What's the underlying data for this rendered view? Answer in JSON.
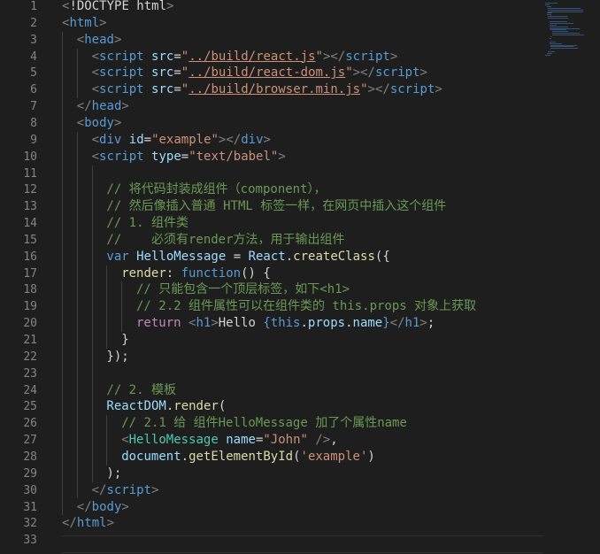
{
  "editor": {
    "line_numbers": [
      "1",
      "2",
      "3",
      "4",
      "5",
      "6",
      "7",
      "8",
      "9",
      "10",
      "11",
      "12",
      "13",
      "14",
      "15",
      "16",
      "17",
      "18",
      "19",
      "20",
      "21",
      "22",
      "23",
      "24",
      "25",
      "26",
      "27",
      "28",
      "29",
      "30",
      "31",
      "32",
      "33"
    ],
    "lines": [
      {
        "indent": 0,
        "tokens": [
          {
            "t": "<",
            "c": "punc"
          },
          {
            "t": "!DOCTYPE html",
            "c": "doctype"
          },
          {
            "t": ">",
            "c": "punc"
          }
        ]
      },
      {
        "indent": 0,
        "tokens": [
          {
            "t": "<",
            "c": "punc"
          },
          {
            "t": "html",
            "c": "tag"
          },
          {
            "t": ">",
            "c": "punc"
          }
        ]
      },
      {
        "indent": 1,
        "tokens": [
          {
            "t": "<",
            "c": "punc"
          },
          {
            "t": "head",
            "c": "tag"
          },
          {
            "t": ">",
            "c": "punc"
          }
        ]
      },
      {
        "indent": 2,
        "tokens": [
          {
            "t": "<",
            "c": "punc"
          },
          {
            "t": "script",
            "c": "tag"
          },
          {
            "t": " ",
            "c": "txt"
          },
          {
            "t": "src",
            "c": "attr"
          },
          {
            "t": "=",
            "c": "txt"
          },
          {
            "t": "\"",
            "c": "str"
          },
          {
            "t": "../build/react.js",
            "c": "link"
          },
          {
            "t": "\"",
            "c": "str"
          },
          {
            "t": "></",
            "c": "punc"
          },
          {
            "t": "script",
            "c": "tag"
          },
          {
            "t": ">",
            "c": "punc"
          }
        ]
      },
      {
        "indent": 2,
        "tokens": [
          {
            "t": "<",
            "c": "punc"
          },
          {
            "t": "script",
            "c": "tag"
          },
          {
            "t": " ",
            "c": "txt"
          },
          {
            "t": "src",
            "c": "attr"
          },
          {
            "t": "=",
            "c": "txt"
          },
          {
            "t": "\"",
            "c": "str"
          },
          {
            "t": "../build/react-dom.js",
            "c": "link"
          },
          {
            "t": "\"",
            "c": "str"
          },
          {
            "t": "></",
            "c": "punc"
          },
          {
            "t": "script",
            "c": "tag"
          },
          {
            "t": ">",
            "c": "punc"
          }
        ]
      },
      {
        "indent": 2,
        "tokens": [
          {
            "t": "<",
            "c": "punc"
          },
          {
            "t": "script",
            "c": "tag"
          },
          {
            "t": " ",
            "c": "txt"
          },
          {
            "t": "src",
            "c": "attr"
          },
          {
            "t": "=",
            "c": "txt"
          },
          {
            "t": "\"",
            "c": "str"
          },
          {
            "t": "../build/browser.min.js",
            "c": "link"
          },
          {
            "t": "\"",
            "c": "str"
          },
          {
            "t": "></",
            "c": "punc"
          },
          {
            "t": "script",
            "c": "tag"
          },
          {
            "t": ">",
            "c": "punc"
          }
        ]
      },
      {
        "indent": 1,
        "tokens": [
          {
            "t": "</",
            "c": "punc"
          },
          {
            "t": "head",
            "c": "tag"
          },
          {
            "t": ">",
            "c": "punc"
          }
        ]
      },
      {
        "indent": 1,
        "tokens": [
          {
            "t": "<",
            "c": "punc"
          },
          {
            "t": "body",
            "c": "tag"
          },
          {
            "t": ">",
            "c": "punc"
          }
        ]
      },
      {
        "indent": 2,
        "tokens": [
          {
            "t": "<",
            "c": "punc"
          },
          {
            "t": "div",
            "c": "tag"
          },
          {
            "t": " ",
            "c": "txt"
          },
          {
            "t": "id",
            "c": "attr"
          },
          {
            "t": "=",
            "c": "txt"
          },
          {
            "t": "\"example\"",
            "c": "str"
          },
          {
            "t": "></",
            "c": "punc"
          },
          {
            "t": "div",
            "c": "tag"
          },
          {
            "t": ">",
            "c": "punc"
          }
        ]
      },
      {
        "indent": 2,
        "tokens": [
          {
            "t": "<",
            "c": "punc"
          },
          {
            "t": "script",
            "c": "tag"
          },
          {
            "t": " ",
            "c": "txt"
          },
          {
            "t": "type",
            "c": "attr"
          },
          {
            "t": "=",
            "c": "txt"
          },
          {
            "t": "\"text/babel\"",
            "c": "str"
          },
          {
            "t": ">",
            "c": "punc"
          }
        ]
      },
      {
        "indent": 0,
        "tokens": []
      },
      {
        "indent": 3,
        "tokens": [
          {
            "t": "// 将代码封装成组件（component），",
            "c": "com"
          }
        ]
      },
      {
        "indent": 3,
        "tokens": [
          {
            "t": "// 然后像插入普通 HTML 标签一样，在网页中插入这个组件",
            "c": "com"
          }
        ]
      },
      {
        "indent": 3,
        "tokens": [
          {
            "t": "// 1. 组件类",
            "c": "com"
          }
        ]
      },
      {
        "indent": 3,
        "tokens": [
          {
            "t": "//    必须有render方法，用于输出组件",
            "c": "com"
          }
        ]
      },
      {
        "indent": 3,
        "tokens": [
          {
            "t": "var",
            "c": "kw"
          },
          {
            "t": " ",
            "c": "txt"
          },
          {
            "t": "HelloMessage",
            "c": "var"
          },
          {
            "t": " = ",
            "c": "txt"
          },
          {
            "t": "React",
            "c": "var"
          },
          {
            "t": ".",
            "c": "txt"
          },
          {
            "t": "createClass",
            "c": "fn"
          },
          {
            "t": "({",
            "c": "txt"
          }
        ]
      },
      {
        "indent": 4,
        "tokens": [
          {
            "t": "render",
            "c": "fn"
          },
          {
            "t": ": ",
            "c": "txt"
          },
          {
            "t": "function",
            "c": "kw"
          },
          {
            "t": "() {",
            "c": "txt"
          }
        ]
      },
      {
        "indent": 5,
        "tokens": [
          {
            "t": "// 只能包含一个顶层标签，如下<h1>",
            "c": "com"
          }
        ]
      },
      {
        "indent": 5,
        "tokens": [
          {
            "t": "// 2.2 组件属性可以在组件类的 this.props 对象上获取",
            "c": "com"
          }
        ]
      },
      {
        "indent": 5,
        "tokens": [
          {
            "t": "return",
            "c": "ctrl"
          },
          {
            "t": " ",
            "c": "txt"
          },
          {
            "t": "<",
            "c": "punc"
          },
          {
            "t": "h1",
            "c": "tag"
          },
          {
            "t": ">",
            "c": "punc"
          },
          {
            "t": "Hello ",
            "c": "txt"
          },
          {
            "t": "{",
            "c": "brace"
          },
          {
            "t": "this",
            "c": "kw"
          },
          {
            "t": ".",
            "c": "txt"
          },
          {
            "t": "props",
            "c": "var"
          },
          {
            "t": ".",
            "c": "txt"
          },
          {
            "t": "name",
            "c": "var"
          },
          {
            "t": "}",
            "c": "brace"
          },
          {
            "t": "</",
            "c": "punc"
          },
          {
            "t": "h1",
            "c": "tag"
          },
          {
            "t": ">",
            "c": "punc"
          },
          {
            "t": ";",
            "c": "txt"
          }
        ]
      },
      {
        "indent": 4,
        "tokens": [
          {
            "t": "}",
            "c": "txt"
          }
        ]
      },
      {
        "indent": 3,
        "tokens": [
          {
            "t": "});",
            "c": "txt"
          }
        ]
      },
      {
        "indent": 0,
        "tokens": []
      },
      {
        "indent": 3,
        "tokens": [
          {
            "t": "// 2. 模板",
            "c": "com"
          }
        ]
      },
      {
        "indent": 3,
        "tokens": [
          {
            "t": "ReactDOM",
            "c": "var"
          },
          {
            "t": ".",
            "c": "txt"
          },
          {
            "t": "render",
            "c": "fn"
          },
          {
            "t": "(",
            "c": "txt"
          }
        ]
      },
      {
        "indent": 4,
        "tokens": [
          {
            "t": "// 2.1 给 组件HelloMessage 加了个属性name",
            "c": "com"
          }
        ]
      },
      {
        "indent": 4,
        "tokens": [
          {
            "t": "<",
            "c": "punc"
          },
          {
            "t": "HelloMessage",
            "c": "comp"
          },
          {
            "t": " ",
            "c": "txt"
          },
          {
            "t": "name",
            "c": "attr"
          },
          {
            "t": "=",
            "c": "txt"
          },
          {
            "t": "\"John\"",
            "c": "str"
          },
          {
            "t": " />",
            "c": "punc"
          },
          {
            "t": ",",
            "c": "txt"
          }
        ]
      },
      {
        "indent": 4,
        "tokens": [
          {
            "t": "document",
            "c": "var"
          },
          {
            "t": ".",
            "c": "txt"
          },
          {
            "t": "getElementById",
            "c": "fn"
          },
          {
            "t": "(",
            "c": "txt"
          },
          {
            "t": "'example'",
            "c": "str"
          },
          {
            "t": ")",
            "c": "txt"
          }
        ]
      },
      {
        "indent": 3,
        "tokens": [
          {
            "t": ");",
            "c": "txt"
          }
        ]
      },
      {
        "indent": 2,
        "tokens": [
          {
            "t": "</",
            "c": "punc"
          },
          {
            "t": "script",
            "c": "tag"
          },
          {
            "t": ">",
            "c": "punc"
          }
        ]
      },
      {
        "indent": 1,
        "tokens": [
          {
            "t": "</",
            "c": "punc"
          },
          {
            "t": "body",
            "c": "tag"
          },
          {
            "t": ">",
            "c": "punc"
          }
        ]
      },
      {
        "indent": 0,
        "tokens": [
          {
            "t": "</",
            "c": "punc"
          },
          {
            "t": "html",
            "c": "tag"
          },
          {
            "t": ">",
            "c": "punc"
          }
        ]
      },
      {
        "indent": 0,
        "tokens": []
      }
    ],
    "guides": [
      {
        "level": 0,
        "from": 3,
        "to": 31
      },
      {
        "level": 1,
        "from": 4,
        "to": 6
      },
      {
        "level": 1,
        "from": 9,
        "to": 30
      },
      {
        "level": 2,
        "from": 11,
        "to": 29
      },
      {
        "level": 3,
        "from": 17,
        "to": 21
      },
      {
        "level": 3,
        "from": 26,
        "to": 28
      },
      {
        "level": 4,
        "from": 18,
        "to": 20
      }
    ]
  }
}
